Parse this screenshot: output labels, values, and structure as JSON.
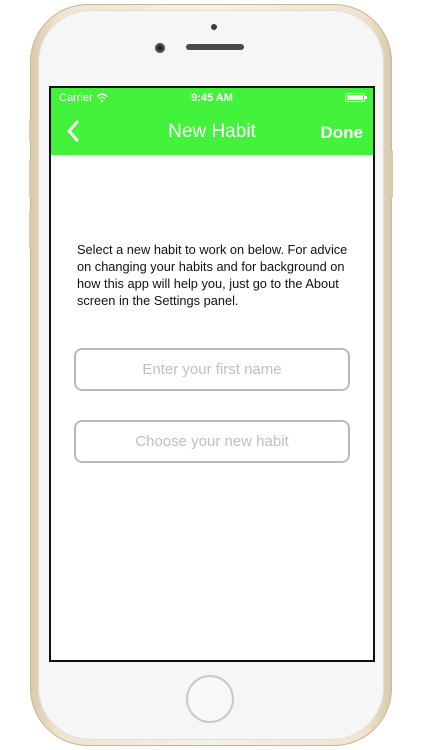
{
  "status_bar": {
    "carrier": "Carrier",
    "time": "9:45 AM"
  },
  "nav_bar": {
    "title": "New Habit",
    "done_label": "Done",
    "back_icon": "chevron-left-icon"
  },
  "body": {
    "instructions": "Select a new habit to work on below. For advice on changing your habits and for background on how this app will help you, just go to the About screen in the Settings panel."
  },
  "form": {
    "name_field": {
      "value": "",
      "placeholder": "Enter your first name"
    },
    "habit_field": {
      "value": "",
      "placeholder": "Choose your new habit"
    }
  },
  "colors": {
    "accent": "#43f23a",
    "nav_text": "#ffffff",
    "field_border": "#b9b9b9",
    "placeholder": "#bfbfbf"
  }
}
